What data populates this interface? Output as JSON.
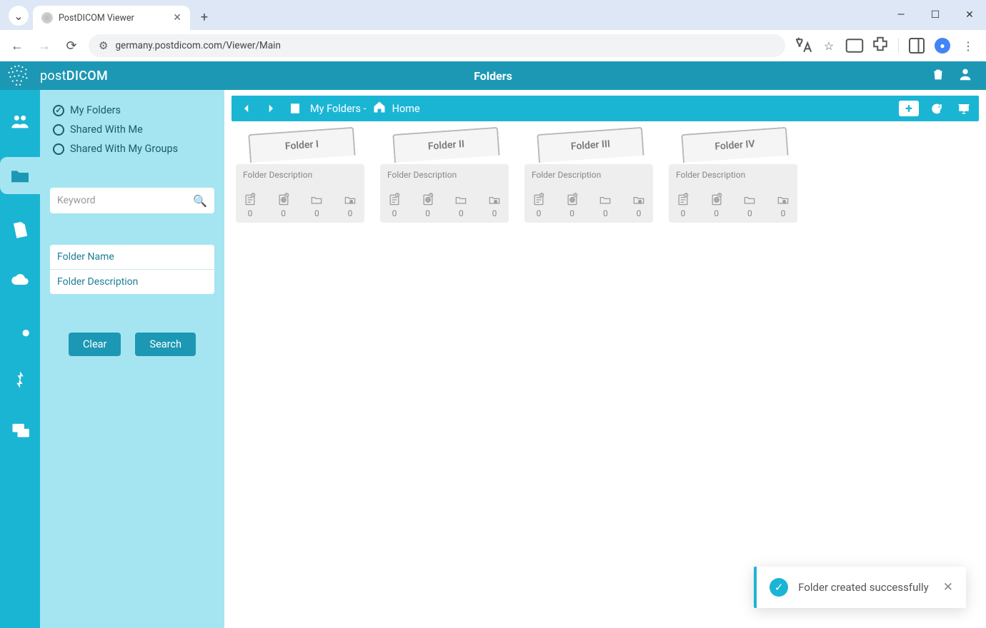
{
  "browser": {
    "tab_title": "PostDICOM Viewer",
    "url": "germany.postdicom.com/Viewer/Main"
  },
  "brand": {
    "pre": "post",
    "main": "DICOM"
  },
  "header_title": "Folders",
  "sidebar": {
    "radios": {
      "my": "My Folders",
      "shared_me": "Shared With Me",
      "shared_groups": "Shared With My Groups"
    },
    "search_placeholder": "Keyword",
    "folder_name_ph": "Folder Name",
    "folder_desc_ph": "Folder Description",
    "clear": "Clear",
    "search": "Search"
  },
  "breadcrumb": {
    "pre": "My Folders - ",
    "home": "Home"
  },
  "folders": [
    {
      "name": "Folder I",
      "desc": "Folder Description",
      "c": [
        "0",
        "0",
        "0",
        "0"
      ]
    },
    {
      "name": "Folder II",
      "desc": "Folder Description",
      "c": [
        "0",
        "0",
        "0",
        "0"
      ]
    },
    {
      "name": "Folder III",
      "desc": "Folder Description",
      "c": [
        "0",
        "0",
        "0",
        "0"
      ]
    },
    {
      "name": "Folder IV",
      "desc": "Folder Description",
      "c": [
        "0",
        "0",
        "0",
        "0"
      ]
    }
  ],
  "toast": {
    "message": "Folder created successfully"
  }
}
